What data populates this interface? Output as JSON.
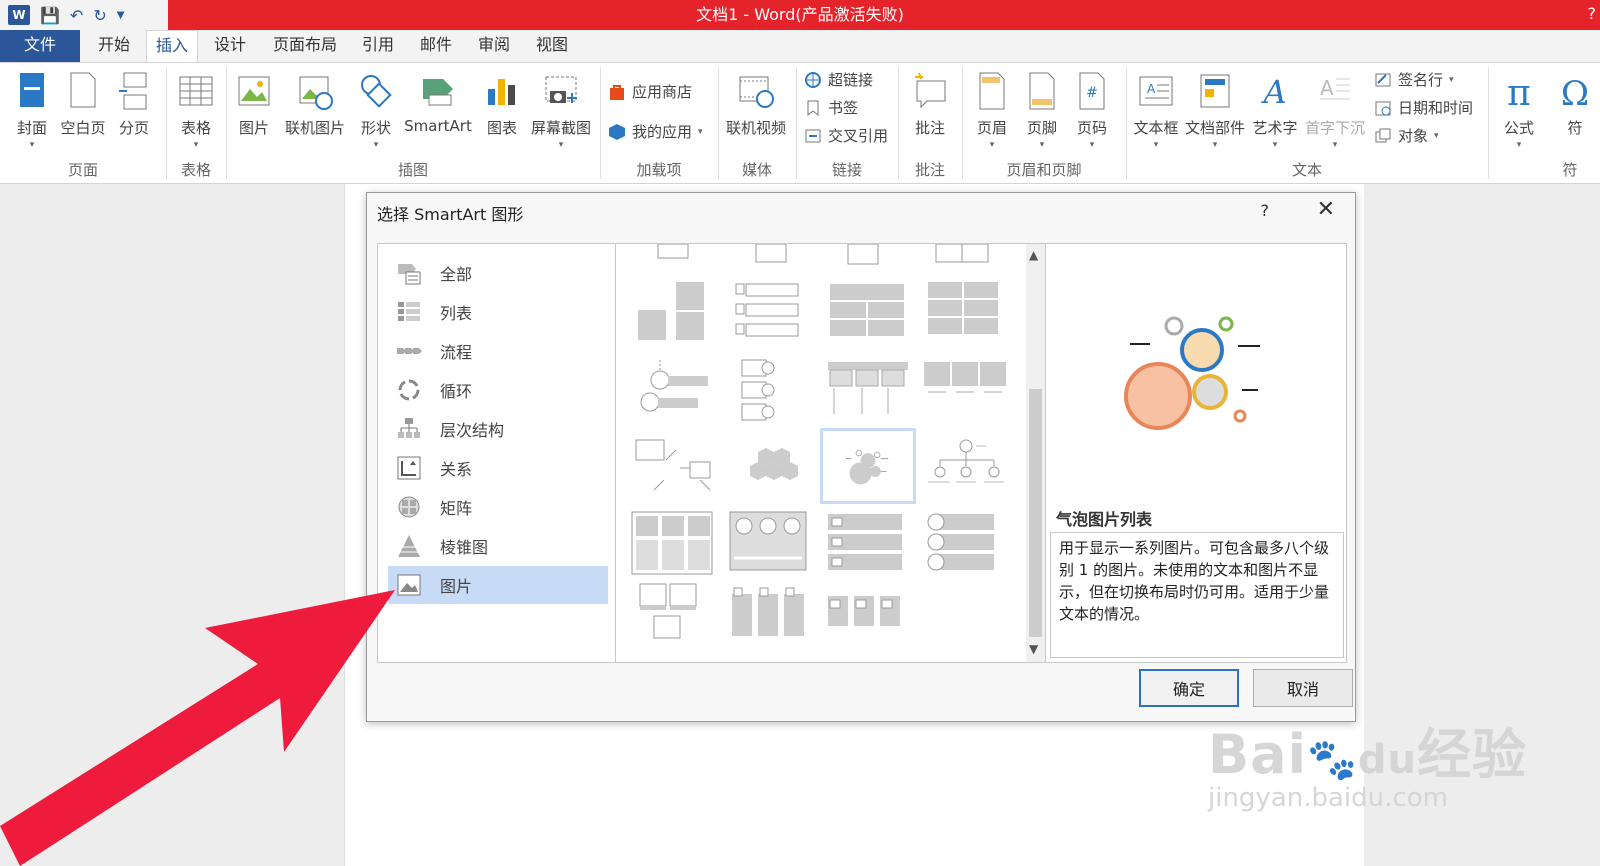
{
  "window": {
    "title": "文档1 -  Word(产品激活失败)",
    "help": "?"
  },
  "tabs": [
    {
      "label": "文件"
    },
    {
      "label": "开始"
    },
    {
      "label": "插入"
    },
    {
      "label": "设计"
    },
    {
      "label": "页面布局"
    },
    {
      "label": "引用"
    },
    {
      "label": "邮件"
    },
    {
      "label": "审阅"
    },
    {
      "label": "视图"
    }
  ],
  "ribbon": {
    "pages": {
      "cover": "封面",
      "blank": "空白页",
      "break": "分页",
      "group": "页面"
    },
    "tables": {
      "table": "表格",
      "group": "表格"
    },
    "illustrations": {
      "picture": "图片",
      "online_picture": "联机图片",
      "shapes": "形状",
      "smartart": "SmartArt",
      "chart": "图表",
      "screenshot": "屏幕截图",
      "group": "插图"
    },
    "addins": {
      "store": "应用商店",
      "my_apps": "我的应用",
      "group": "加载项"
    },
    "media": {
      "online_video": "联机视频",
      "group": "媒体"
    },
    "links": {
      "hyperlink": "超链接",
      "bookmark": "书签",
      "cross_ref": "交叉引用",
      "group": "链接"
    },
    "comments": {
      "comment": "批注",
      "group": "批注"
    },
    "header_footer": {
      "header": "页眉",
      "footer": "页脚",
      "page_number": "页码",
      "group": "页眉和页脚"
    },
    "text": {
      "textbox": "文本框",
      "quick_parts": "文档部件",
      "wordart": "艺术字",
      "dropcap": "首字下沉",
      "signature": "签名行",
      "datetime": "日期和时间",
      "object": "对象",
      "group": "文本"
    },
    "symbols": {
      "equation": "公式",
      "symbol": "符",
      "group": "符"
    }
  },
  "dialog": {
    "title": "选择 SmartArt 图形",
    "help": "?",
    "categories": [
      {
        "label": "全部"
      },
      {
        "label": "列表"
      },
      {
        "label": "流程"
      },
      {
        "label": "循环"
      },
      {
        "label": "层次结构"
      },
      {
        "label": "关系"
      },
      {
        "label": "矩阵"
      },
      {
        "label": "棱锥图"
      },
      {
        "label": "图片"
      }
    ],
    "preview_title": "气泡图片列表",
    "preview_desc": "用于显示一系列图片。可包含最多八个级别 1 的图片。未使用的文本和图片不显示，但在切换布局时仍可用。适用于少量文本的情况。",
    "ok_label": "确定",
    "cancel_label": "取消"
  },
  "watermark": {
    "main": "Bai",
    "paw": "du",
    "cn": "经验",
    "url": "jingyan.baidu.com"
  },
  "colors": {
    "title_bar": "#e5232a",
    "word_blue": "#2b579a",
    "selection": "#c7daf6",
    "arrow_red": "#ee1b3c"
  }
}
